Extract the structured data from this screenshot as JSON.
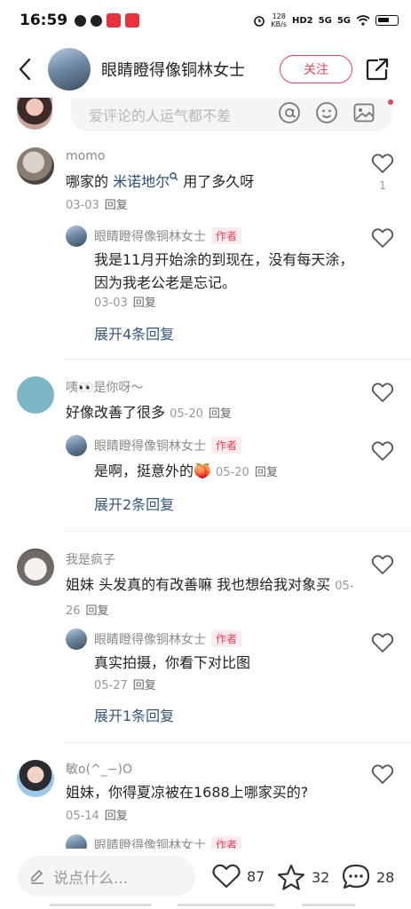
{
  "status_bar": {
    "time": "16:59",
    "net_speed": "128\nKB/s",
    "net_line1": "128",
    "net_line2": "KB/s",
    "sig1": "5G",
    "sig2": "5G",
    "hd": "HD2"
  },
  "header": {
    "title": "眼睛瞪得像铜林女士",
    "follow_label": "关注"
  },
  "comment_input": {
    "placeholder": "爱评论的人运气都不差"
  },
  "comments": [
    {
      "user": "momo",
      "text_prefix": "哪家的 ",
      "link": "米诺地尔",
      "text_suffix": "  用了多久呀",
      "date": "03-03",
      "reply_label": "回复",
      "likes": "1",
      "sub_reply": {
        "user": "眼睛瞪得像铜林女士",
        "tag": "作者",
        "text": "我是11月开始涂的到现在，没有每天涂，因为我老公老是忘记。",
        "date": "03-03",
        "reply_label": "回复"
      },
      "expand_label": "展开4条回复"
    },
    {
      "user": "咦👀是你呀～",
      "text": "好像改善了很多",
      "date": "05-20",
      "reply_label": "回复",
      "sub_reply": {
        "user": "眼睛瞪得像铜林女士",
        "tag": "作者",
        "text": "是啊，挺意外的🍑",
        "date": "05-20",
        "reply_label": "回复"
      },
      "expand_label": "展开2条回复"
    },
    {
      "user": "我是疯子",
      "text": "姐妹 头发真的有改善嘛 我也想给我对象买",
      "date": "05-26",
      "reply_label": "回复",
      "sub_reply": {
        "user": "眼睛瞪得像铜林女士",
        "tag": "作者",
        "text": "真实拍摄，你看下对比图",
        "date": "05-27",
        "reply_label": "回复"
      },
      "expand_label": "展开1条回复"
    },
    {
      "user": "敏o(^_−)O",
      "text": "姐妹，你得夏凉被在1688上哪家买的?",
      "date": "05-14",
      "reply_label": "回复",
      "sub_reply": {
        "user": "眼睛瞪得像铜林女士",
        "tag": "作者"
      }
    }
  ],
  "bottom_bar": {
    "input_placeholder": "说点什么...",
    "likes": "87",
    "collects": "32",
    "comments": "28"
  },
  "colors": {
    "accent": "#ef3f57",
    "link": "#35557a"
  }
}
